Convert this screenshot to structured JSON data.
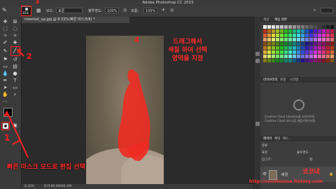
{
  "app": {
    "title": "Adobe Photoshop CC 2015"
  },
  "options": {
    "brush_size": "163",
    "mode_label": "모드:",
    "mode_value": "표준",
    "opacity_label": "불투명도:",
    "opacity_value": "100%",
    "flow_label": "흐름:",
    "flow_value": "100%"
  },
  "document": {
    "tab_label": "meerkat_up.jpg @ 8.33%(빠른 마스크/8) *",
    "status_zoom": "8.33%",
    "status_doc": "문서:60.2M/60.2M"
  },
  "panels": {
    "color_tabs": [
      "색상",
      "색상 견본"
    ],
    "library_tabs": [
      "라이브러리",
      "조정",
      "스타일"
    ],
    "library_text_1": "Creative Cloud Libraries를 사용하려면",
    "library_text_2": "Creative Cloud 데스크탑 애플리케이션을",
    "layers_tabs": [
      "레이어",
      "채널",
      "패스"
    ],
    "layer_kind": "종류",
    "layer_blend": "표준",
    "layer_opacity": "불투명도:",
    "layer_lock": "잠그기:",
    "layer_fill": "칠:",
    "layer_name": "배경"
  },
  "annotations": {
    "num1": "1",
    "num2": "2",
    "num3": "3",
    "num4": "4",
    "instruction_line1": "드래그해서",
    "instruction_line2": "색칠 하여 선택",
    "instruction_line3": "영역을 지정",
    "bottom_caption": "빠른 마스크 모드로 편집 선택",
    "author": "코코네",
    "url": "http://cocohouse.tistory.com"
  },
  "colors": {
    "accent_red": "#ff2020",
    "mask_red": "#ee2b22"
  }
}
